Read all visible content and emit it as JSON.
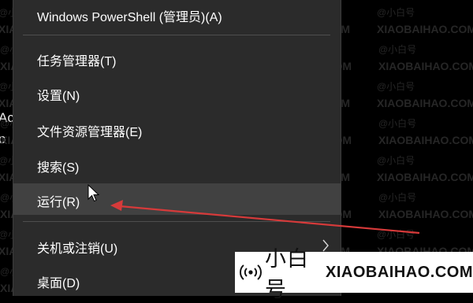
{
  "edge_text": "Ac\no",
  "menu": {
    "items": [
      {
        "label": "Windows PowerShell (管理员)(A)"
      },
      {
        "label": "任务管理器(T)"
      },
      {
        "label": "设置(N)"
      },
      {
        "label": "文件资源管理器(E)"
      },
      {
        "label": "搜索(S)"
      },
      {
        "label": "运行(R)",
        "hover": true
      },
      {
        "label": "关机或注销(U)",
        "submenu": true
      },
      {
        "label": "桌面(D)"
      }
    ],
    "submenu_icon": "chevron-right-icon"
  },
  "annotation": {
    "arrow_color": "#d63a3a",
    "icon": "red-arrow-icon"
  },
  "cursor": {
    "icon": "mouse-pointer-icon"
  },
  "watermark": {
    "bg_text": "XIAOBAIHAO.COM",
    "bg_cn": "@小白号",
    "banner_cn": "小白号",
    "banner_en": "XIAOBAIHAO.COM",
    "icon": "broadcast-signal-icon"
  }
}
